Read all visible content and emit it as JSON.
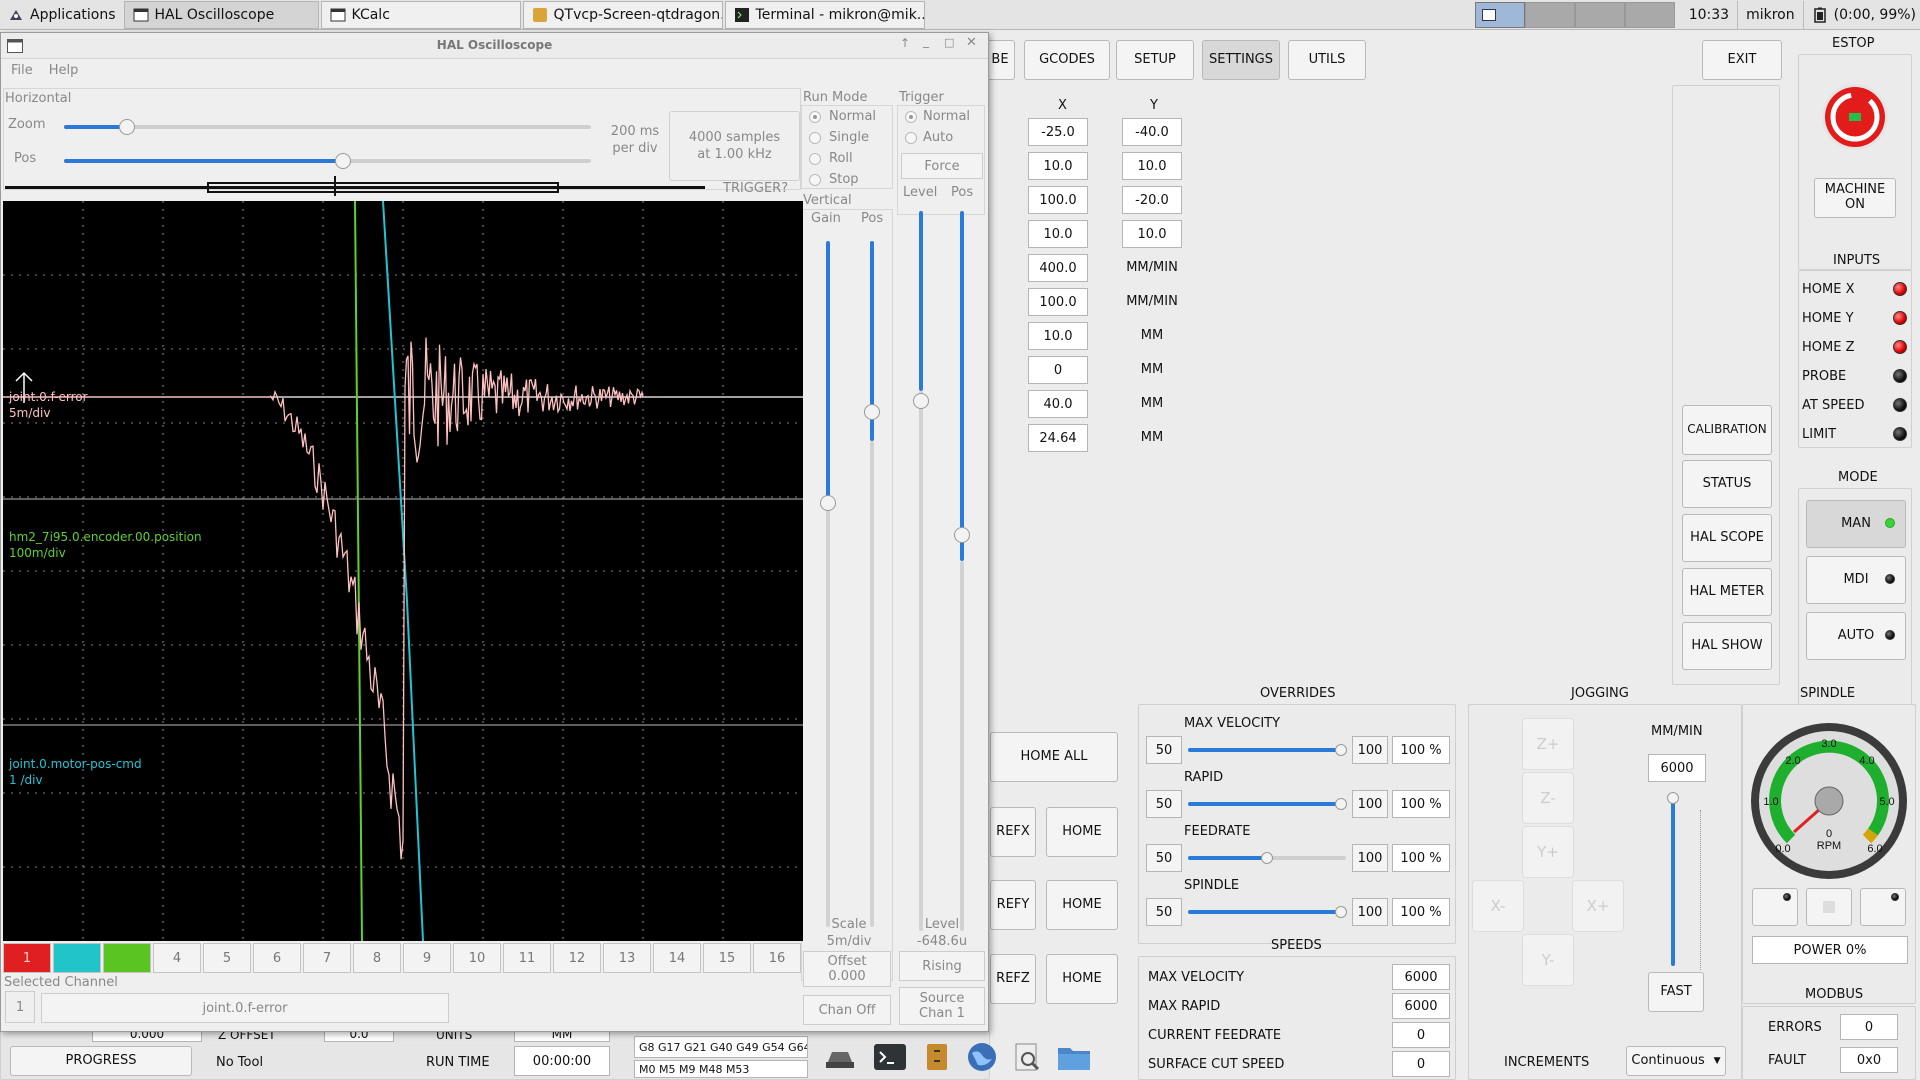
{
  "taskbar": {
    "applications": "Applications",
    "tasks": [
      "HAL Oscilloscope",
      "KCalc",
      "QTvcp-Screen-qtdragon...",
      "Terminal - mikron@mik..."
    ],
    "clock": "10:33",
    "user": "mikron",
    "battery": "(0:00, 99%)"
  },
  "top_tabs": [
    "BE",
    "GCODES",
    "SETUP",
    "SETTINGS",
    "UTILS"
  ],
  "exit_label": "EXIT",
  "estop": {
    "title": "ESTOP",
    "machine_on": "MACHINE ON"
  },
  "inputs": {
    "title": "INPUTS",
    "items": [
      {
        "label": "HOME X",
        "state": "red"
      },
      {
        "label": "HOME Y",
        "state": "red"
      },
      {
        "label": "HOME Z",
        "state": "red"
      },
      {
        "label": "PROBE",
        "state": "off"
      },
      {
        "label": "AT SPEED",
        "state": "off"
      },
      {
        "label": "LIMIT",
        "state": "off"
      }
    ]
  },
  "mode": {
    "title": "MODE",
    "items": [
      "MAN",
      "MDI",
      "AUTO"
    ]
  },
  "settings_table": {
    "col_x": "X",
    "col_y": "Y",
    "rows": [
      {
        "x": "-25.0",
        "y": "-40.0",
        "y_is_field": true
      },
      {
        "x": "10.0",
        "y": "10.0",
        "y_is_field": true
      },
      {
        "x": "100.0",
        "y": "-20.0",
        "y_is_field": true
      },
      {
        "x": "10.0",
        "y": "10.0",
        "y_is_field": true
      },
      {
        "x": "400.0",
        "y": "MM/MIN",
        "y_is_field": false
      },
      {
        "x": "100.0",
        "y": "MM/MIN",
        "y_is_field": false
      },
      {
        "x": "10.0",
        "y": "MM",
        "y_is_field": false
      },
      {
        "x": "0",
        "y": "MM",
        "y_is_field": false
      },
      {
        "x": "40.0",
        "y": "MM",
        "y_is_field": false
      },
      {
        "x": "24.64",
        "y": "MM",
        "y_is_field": false
      }
    ]
  },
  "side_tools": [
    "CALIBRATION",
    "STATUS",
    "HAL SCOPE",
    "HAL METER",
    "HAL SHOW"
  ],
  "home_buttons": {
    "home_all": "HOME ALL",
    "refx": "REFX",
    "refy": "REFY",
    "refz": "REFZ",
    "home": "HOME"
  },
  "overrides": {
    "title": "OVERRIDES",
    "items": [
      {
        "label": "MAX VELOCITY",
        "min": "50",
        "max": "100",
        "pct": "100 %",
        "level": 0.97
      },
      {
        "label": "RAPID",
        "min": "50",
        "max": "100",
        "pct": "100 %",
        "level": 0.97
      },
      {
        "label": "FEEDRATE",
        "min": "50",
        "max": "100",
        "pct": "100 %",
        "level": 0.5
      },
      {
        "label": "SPINDLE",
        "min": "50",
        "max": "100",
        "pct": "100 %",
        "level": 0.97
      }
    ]
  },
  "speeds": {
    "title": "SPEEDS",
    "items": [
      {
        "label": "MAX VELOCITY",
        "value": "6000"
      },
      {
        "label": "MAX RAPID",
        "value": "6000"
      },
      {
        "label": "CURRENT FEEDRATE",
        "value": "0"
      },
      {
        "label": "SURFACE CUT SPEED",
        "value": "0"
      }
    ]
  },
  "jogging": {
    "title": "JOGGING",
    "units": "MM/MIN",
    "rate": "6000",
    "fast": "FAST",
    "increments_label": "INCREMENTS",
    "increments_value": "Continuous",
    "buttons": [
      "Z+",
      "Z-",
      "Y+",
      "X-",
      "X+",
      "Y-"
    ]
  },
  "spindle": {
    "title": "SPINDLE",
    "gauge_labels": [
      "0.0",
      "1.0",
      "2.0",
      "3.0",
      "4.0",
      "5.0",
      "6.0"
    ],
    "gauge_unit": "RPM",
    "gauge_value": "0",
    "power": "POWER 0%"
  },
  "modbus": {
    "title": "MODBUS",
    "errors_label": "ERRORS",
    "errors": "0",
    "fault_label": "FAULT",
    "fault": "0x0"
  },
  "bottom": {
    "progress": "PROGRESS",
    "tool": "No Tool",
    "run_time_label": "RUN TIME",
    "run_time": "00:00:00",
    "gcodes": "G8 G17 G21 G40 G49 G54 G64",
    "mcodes": "M0 M5 M9 M48 M53",
    "partial_0000": "0.000",
    "partial_zoffset": "Z OFFSET",
    "partial_00": "0.0",
    "partial_units": "UNITS",
    "partial_mm": "MM"
  },
  "scope": {
    "title": "HAL Oscilloscope",
    "menu": [
      "File",
      "Help"
    ],
    "horizontal": "Horizontal",
    "zoom": "Zoom",
    "pos": "Pos",
    "zoom_level": 0.12,
    "pos_level": 0.53,
    "per_div": "200 ms per div",
    "samples": "4000 samples at 1.00 kHz",
    "trigger_status": "TRIGGER?",
    "run_mode": "Run Mode",
    "run_modes": [
      "Normal",
      "Single",
      "Roll",
      "Stop"
    ],
    "trigger": "Trigger",
    "trigger_modes": [
      "Normal",
      "Auto"
    ],
    "force": "Force",
    "vertical": "Vertical",
    "gain": "Gain",
    "vpos": "Pos",
    "level": "Level",
    "level_pos": "Pos",
    "scale_label": "Scale",
    "scale_value": "5m/div",
    "offset_label": "Offset",
    "offset_value": "0.000",
    "chan_off": "Chan Off",
    "level_label": "Level",
    "level_value": "-648.6u",
    "rising": "Rising",
    "source_label": "Source",
    "source_value": "Chan  1",
    "channels": [
      "1",
      "2",
      "3",
      "4",
      "5",
      "6",
      "7",
      "8",
      "9",
      "10",
      "11",
      "12",
      "13",
      "14",
      "15",
      "16"
    ],
    "selected_channel_label": "Selected Channel",
    "selected_channel_num": "1",
    "selected_channel_name": "joint.0.f-error",
    "traces": [
      {
        "name": "joint.0.f-error",
        "scale": "5m/div",
        "color": "#ffc0c0"
      },
      {
        "name": "hm2_7i95.0.encoder.00.position",
        "scale": "100m/div",
        "color": "#5fd02e"
      },
      {
        "name": "joint.0.motor-pos-cmd",
        "scale": "1 /div",
        "color": "#22c4d4"
      }
    ]
  }
}
